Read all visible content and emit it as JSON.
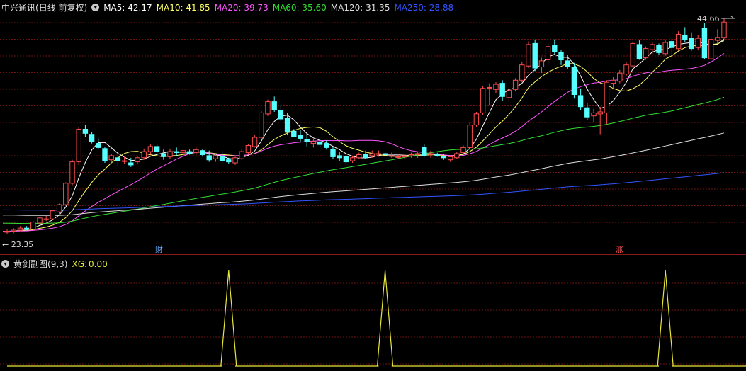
{
  "stock": {
    "name": "中兴通讯",
    "mode": "(日线 前复权)"
  },
  "ma_legend": [
    {
      "label": "MA5:",
      "value": "42.17",
      "color": "#ffffff"
    },
    {
      "label": "MA10:",
      "value": "41.85",
      "color": "#ffff66"
    },
    {
      "label": "MA20:",
      "value": "39.73",
      "color": "#ff55ff"
    },
    {
      "label": "MA60:",
      "value": "35.60",
      "color": "#33dd33"
    },
    {
      "label": "MA120:",
      "value": "31.35",
      "color": "#dddddd"
    },
    {
      "label": "MA250:",
      "value": "28.88",
      "color": "#3355ff"
    }
  ],
  "price_labels": {
    "high": "44.66",
    "low": "← 23.35"
  },
  "events": [
    {
      "text": "财",
      "color": "#66aaff"
    },
    {
      "text": "涨",
      "color": "#ff5555"
    }
  ],
  "indicator": {
    "name": "黄剑副图",
    "params": "(9,3)",
    "xg_label": "XG:",
    "xg_value": "0.00"
  },
  "colors": {
    "up": "#ff4d4d",
    "down": "#55ffff",
    "grid": "#6e1414",
    "background": "#000000"
  },
  "chart_data": [
    {
      "type": "candlestick",
      "ylim": [
        23.35,
        44.66
      ],
      "candles": [
        [
          23.7,
          24.0,
          23.5,
          23.8
        ],
        [
          23.8,
          24.1,
          23.6,
          23.9
        ],
        [
          23.9,
          24.3,
          23.8,
          24.1
        ],
        [
          24.1,
          24.3,
          23.9,
          24.0
        ],
        [
          24.0,
          24.8,
          23.9,
          24.7
        ],
        [
          24.6,
          25.2,
          24.4,
          25.1
        ],
        [
          25.0,
          25.3,
          24.8,
          25.0
        ],
        [
          25.0,
          25.9,
          24.9,
          25.8
        ],
        [
          25.7,
          26.5,
          25.5,
          26.4
        ],
        [
          26.4,
          28.6,
          26.3,
          28.5
        ],
        [
          28.5,
          30.8,
          28.3,
          30.6
        ],
        [
          30.6,
          34.0,
          30.3,
          33.8
        ],
        [
          33.8,
          34.2,
          33.0,
          33.4
        ],
        [
          33.3,
          33.5,
          32.4,
          32.6
        ],
        [
          32.4,
          32.9,
          31.9,
          32.0
        ],
        [
          31.9,
          32.1,
          30.5,
          30.7
        ],
        [
          30.8,
          31.4,
          30.5,
          31.2
        ],
        [
          31.0,
          31.5,
          30.2,
          30.7
        ],
        [
          30.7,
          31.1,
          30.4,
          30.7
        ],
        [
          30.5,
          31.0,
          30.1,
          30.3
        ],
        [
          30.6,
          31.2,
          30.4,
          31.0
        ],
        [
          31.0,
          31.9,
          30.8,
          31.6
        ],
        [
          31.6,
          32.3,
          31.3,
          32.1
        ],
        [
          32.1,
          32.4,
          31.4,
          31.6
        ],
        [
          31.4,
          31.8,
          30.8,
          31.1
        ],
        [
          31.1,
          31.9,
          30.9,
          31.6
        ],
        [
          31.6,
          32.0,
          31.2,
          31.5
        ],
        [
          31.5,
          31.9,
          31.3,
          31.7
        ],
        [
          31.6,
          31.8,
          31.3,
          31.4
        ],
        [
          31.5,
          32.0,
          31.3,
          31.8
        ],
        [
          31.7,
          31.9,
          31.1,
          31.3
        ],
        [
          31.2,
          31.7,
          30.6,
          30.8
        ],
        [
          30.9,
          31.4,
          30.6,
          31.2
        ],
        [
          31.1,
          31.7,
          30.5,
          30.7
        ],
        [
          30.8,
          31.0,
          30.4,
          30.6
        ],
        [
          30.5,
          31.1,
          30.3,
          31.0
        ],
        [
          30.9,
          31.8,
          30.8,
          31.6
        ],
        [
          31.5,
          32.3,
          31.3,
          32.2
        ],
        [
          32.1,
          33.2,
          32.0,
          33.0
        ],
        [
          33.0,
          35.6,
          32.8,
          35.4
        ],
        [
          35.3,
          36.7,
          35.1,
          36.5
        ],
        [
          36.5,
          37.0,
          35.5,
          35.7
        ],
        [
          35.6,
          36.2,
          34.6,
          34.8
        ],
        [
          34.9,
          35.4,
          33.2,
          33.5
        ],
        [
          33.6,
          33.8,
          33.0,
          33.1
        ],
        [
          33.2,
          33.7,
          32.6,
          32.9
        ],
        [
          32.8,
          33.4,
          32.1,
          32.6
        ],
        [
          32.4,
          32.8,
          32.0,
          32.6
        ],
        [
          32.5,
          32.9,
          32.1,
          32.3
        ],
        [
          32.4,
          32.7,
          31.8,
          32.0
        ],
        [
          31.8,
          32.1,
          30.9,
          31.1
        ],
        [
          31.2,
          31.6,
          30.7,
          31.0
        ],
        [
          31.1,
          31.5,
          30.4,
          30.6
        ],
        [
          30.7,
          31.2,
          30.5,
          31.0
        ],
        [
          31.0,
          31.5,
          30.9,
          31.3
        ],
        [
          31.3,
          31.7,
          30.9,
          31.0
        ],
        [
          31.2,
          31.7,
          31.0,
          31.4
        ],
        [
          31.4,
          31.7,
          31.1,
          31.4
        ],
        [
          31.4,
          31.6,
          31.1,
          31.3
        ],
        [
          31.2,
          31.5,
          31.0,
          31.2
        ],
        [
          31.1,
          31.3,
          30.9,
          31.1
        ],
        [
          31.1,
          31.3,
          30.9,
          31.2
        ],
        [
          31.2,
          31.5,
          31.0,
          31.3
        ],
        [
          31.3,
          31.6,
          31.0,
          31.4
        ],
        [
          32.0,
          32.3,
          31.1,
          31.2
        ],
        [
          31.3,
          31.7,
          31.0,
          31.4
        ],
        [
          31.3,
          31.5,
          31.1,
          31.2
        ],
        [
          31.1,
          31.4,
          30.8,
          31.0
        ],
        [
          30.8,
          31.2,
          30.6,
          31.1
        ],
        [
          31.0,
          31.6,
          30.9,
          31.4
        ],
        [
          31.5,
          32.2,
          31.3,
          32.0
        ],
        [
          32.0,
          34.5,
          31.8,
          34.2
        ],
        [
          34.2,
          35.5,
          34.0,
          35.3
        ],
        [
          35.4,
          38.0,
          35.2,
          37.8
        ],
        [
          37.9,
          38.3,
          36.1,
          37.9
        ],
        [
          37.7,
          38.4,
          37.3,
          38.2
        ],
        [
          38.3,
          38.6,
          36.6,
          37.0
        ],
        [
          36.9,
          37.9,
          36.6,
          37.6
        ],
        [
          37.7,
          38.8,
          37.5,
          38.6
        ],
        [
          38.6,
          40.4,
          38.4,
          40.1
        ],
        [
          40.0,
          42.4,
          39.8,
          42.1
        ],
        [
          42.2,
          42.6,
          39.5,
          39.8
        ],
        [
          39.9,
          40.8,
          39.3,
          40.5
        ],
        [
          40.6,
          42.2,
          40.2,
          41.9
        ],
        [
          42.0,
          42.6,
          41.2,
          41.4
        ],
        [
          41.3,
          41.6,
          40.1,
          40.6
        ],
        [
          40.5,
          41.1,
          39.7,
          39.9
        ],
        [
          39.9,
          40.3,
          36.8,
          37.2
        ],
        [
          37.1,
          37.8,
          35.7,
          36.0
        ],
        [
          35.9,
          36.4,
          34.7,
          35.0
        ],
        [
          35.1,
          35.8,
          34.5,
          35.4
        ],
        [
          35.3,
          36.0,
          33.3,
          35.5
        ],
        [
          35.4,
          38.6,
          34.3,
          38.4
        ],
        [
          38.3,
          38.9,
          37.8,
          38.6
        ],
        [
          38.5,
          39.6,
          38.3,
          39.3
        ],
        [
          39.2,
          40.4,
          39.0,
          40.1
        ],
        [
          40.0,
          42.4,
          39.9,
          42.2
        ],
        [
          42.1,
          42.5,
          40.6,
          40.7
        ],
        [
          40.8,
          41.9,
          40.6,
          41.7
        ],
        [
          41.6,
          42.3,
          41.2,
          42.1
        ],
        [
          42.0,
          42.2,
          41.1,
          41.3
        ],
        [
          41.2,
          42.5,
          41.0,
          42.3
        ],
        [
          42.4,
          42.8,
          41.1,
          41.8
        ],
        [
          41.7,
          43.4,
          41.5,
          43.1
        ],
        [
          43.0,
          43.8,
          42.3,
          42.6
        ],
        [
          42.7,
          43.3,
          41.5,
          41.7
        ],
        [
          41.8,
          43.0,
          41.6,
          42.7
        ],
        [
          43.7,
          44.2,
          40.7,
          40.8
        ],
        [
          40.7,
          42.9,
          40.5,
          42.6
        ],
        [
          42.5,
          43.6,
          42.2,
          42.8
        ],
        [
          42.8,
          44.66,
          42.6,
          44.3
        ]
      ]
    },
    {
      "type": "line",
      "series": [
        {
          "name": "XG",
          "values": [
            0,
            0,
            0,
            0,
            0,
            0,
            0,
            0,
            0,
            0,
            0,
            0,
            0,
            0,
            0,
            0,
            0,
            0,
            0,
            0,
            0,
            0,
            0,
            0,
            0,
            0,
            0,
            0,
            0,
            0,
            0,
            0,
            0,
            0,
            0,
            0,
            0,
            0,
            0,
            0,
            0,
            0,
            0,
            0,
            0,
            0,
            0,
            0,
            0,
            0,
            0,
            0,
            0,
            0,
            0,
            0,
            0,
            0,
            0,
            0,
            0,
            0,
            0,
            0,
            0,
            0,
            0,
            0,
            0,
            0,
            0,
            0,
            0,
            0,
            0,
            0,
            0,
            0,
            0,
            0,
            0,
            0,
            0,
            0,
            0,
            0,
            0,
            0,
            0,
            0,
            0,
            0,
            0,
            0,
            0,
            0,
            0,
            0,
            0,
            0,
            0,
            0,
            0,
            0,
            0,
            0,
            0,
            0,
            0,
            0,
            0,
            0,
            0,
            0,
            0,
            0,
            0
          ]
        }
      ],
      "spikes": [
        {
          "x_index": 34,
          "value": 1
        },
        {
          "x_index": 58,
          "value": 1
        },
        {
          "x_index": 101,
          "value": 1
        }
      ],
      "ylim": [
        0,
        1
      ]
    }
  ]
}
